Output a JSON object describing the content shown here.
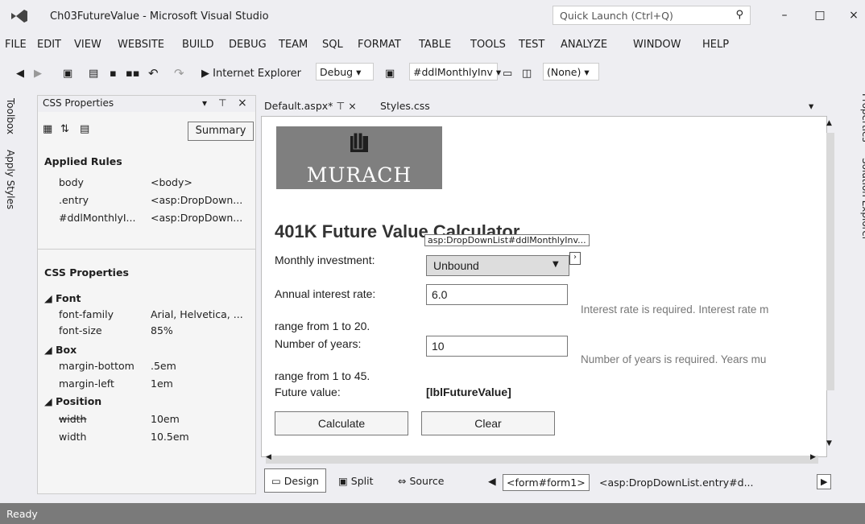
{
  "window": {
    "title": "Ch03FutureValue - Microsoft Visual Studio",
    "quick_launch": "Quick Launch (Ctrl+Q)",
    "minimize": "–",
    "maximize": "□",
    "close": "×"
  },
  "menu": [
    "FILE",
    "EDIT",
    "VIEW",
    "WEBSITE",
    "BUILD",
    "DEBUG",
    "TEAM",
    "SQL",
    "FORMAT",
    "TABLE",
    "TOOLS",
    "TEST",
    "ANALYZE",
    "WINDOW",
    "HELP"
  ],
  "toolbar": {
    "browser": "▶ Internet Explorer",
    "config": "Debug",
    "target_selector": "#ddlMonthlyInv",
    "style_target": "(None)"
  },
  "left_tabs": {
    "toolbox": "Toolbox",
    "apply_styles": "Apply Styles"
  },
  "css_panel": {
    "title": "CSS Properties",
    "summary_btn": "Summary",
    "applied_rules_title": "Applied Rules",
    "applied_rules": [
      {
        "selector": "body",
        "element": "<body>"
      },
      {
        "selector": ".entry",
        "element": "<asp:DropDown..."
      },
      {
        "selector": "#ddlMonthlyI...",
        "element": "<asp:DropDown..."
      }
    ],
    "props_title": "CSS Properties",
    "font_group": "Font",
    "font_family_name": "font-family",
    "font_family_val": "Arial, Helvetica, ...",
    "font_size_name": "font-size",
    "font_size_val": "85%",
    "box_group": "Box",
    "mb_name": "margin-bottom",
    "mb_val": ".5em",
    "ml_name": "margin-left",
    "ml_val": "1em",
    "pos_group": "Position",
    "w1_name": "width",
    "w1_val": "10em",
    "w2_name": "width",
    "w2_val": "10.5em"
  },
  "tabs": [
    {
      "label": "Default.aspx*"
    },
    {
      "label": "Styles.css"
    }
  ],
  "page": {
    "logo_text": "MURACH",
    "heading": "401K Future Value Calculator",
    "tooltip": "asp:DropDownList#ddlMonthlyInv...",
    "monthly_label": "Monthly investment:",
    "monthly_value": "Unbound",
    "rate_label": "Annual interest rate:",
    "rate_value": "6.0",
    "rate_error": "Interest rate is required.   Interest rate m",
    "rate_range": "range from 1 to 20.",
    "years_label": "Number of years:",
    "years_value": "10",
    "years_error": "Number of years is required.   Years mu",
    "years_range": "range from 1 to 45.",
    "future_label": "Future value:",
    "future_value": "[lblFutureValue]",
    "calculate": "Calculate",
    "clear": "Clear"
  },
  "viewbar": {
    "design": "Design",
    "split": "Split",
    "source": "Source",
    "crumb1": "<form#form1>",
    "crumb2": "<asp:DropDownList.entry#d..."
  },
  "right_tabs": {
    "properties": "Properties",
    "solution_explorer": "Solution Explorer"
  },
  "status": "Ready",
  "colors": {
    "status_bar": "#7a7a7a",
    "logo_bg": "#7f7f7f"
  }
}
